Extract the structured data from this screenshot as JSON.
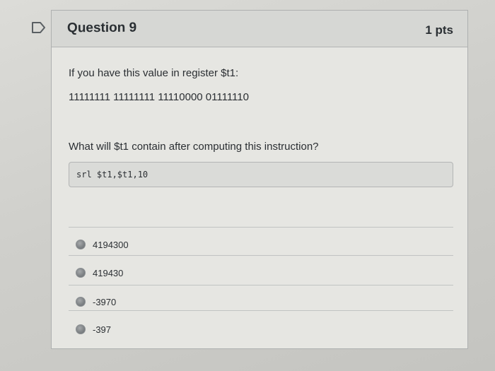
{
  "question": {
    "title": "Question 9",
    "points": "1 pts",
    "prompt_line1": "If you have this value in register $t1:",
    "register_value": "11111111 11111111 11110000 01111110",
    "prompt_line2": "What will $t1 contain after computing this instruction?",
    "instruction": "srl $t1,$t1,10",
    "answers": [
      {
        "label": "4194300"
      },
      {
        "label": "419430"
      },
      {
        "label": "-3970"
      },
      {
        "label": "-397"
      }
    ]
  },
  "icons": {
    "flag": "bookmark-flag-icon",
    "radio": "radio-button-icon"
  },
  "colors": {
    "header_bg": "#d6d7d4",
    "card_bg": "#e6e6e2",
    "text": "#2b2f33"
  }
}
